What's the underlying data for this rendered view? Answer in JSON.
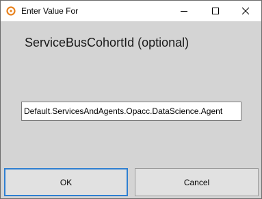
{
  "window": {
    "title": "Enter Value For",
    "icon": "orange-ring-app-icon",
    "controls": {
      "minimize_icon": "minimize-icon",
      "maximize_icon": "maximize-icon",
      "close_icon": "close-icon"
    }
  },
  "prompt": {
    "label": "ServiceBusCohortId (optional)"
  },
  "input": {
    "value": "Default.ServicesAndAgents.Opacc.DataScience.Agent"
  },
  "buttons": {
    "ok_label": "OK",
    "cancel_label": "Cancel"
  },
  "colors": {
    "dialog_background": "#d4d4d4",
    "titlebar_background": "#ffffff",
    "focus_border": "#2e7fd1",
    "app_icon_accent": "#e8821e"
  }
}
